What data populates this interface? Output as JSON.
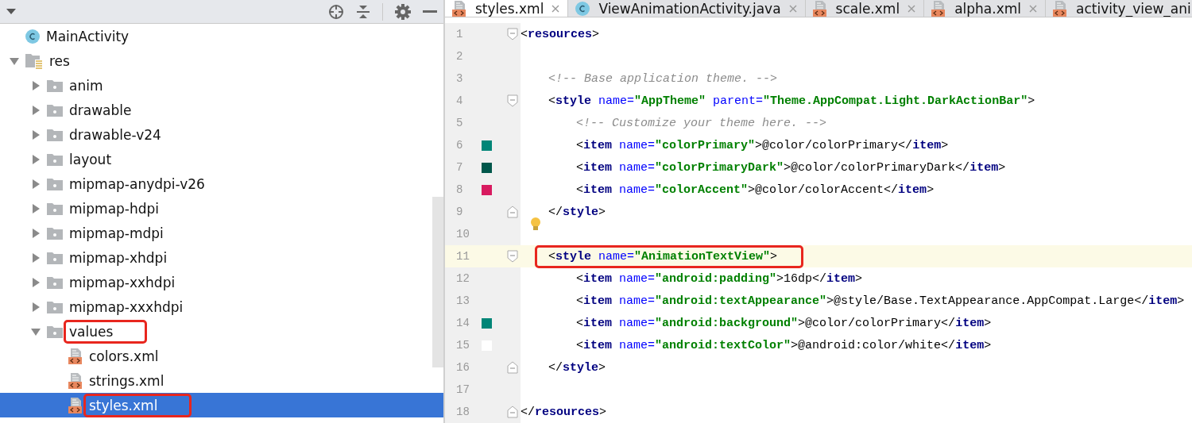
{
  "project": {
    "tree": [
      {
        "label": "MainActivity",
        "kind": "class",
        "selected": false,
        "highlighted": false
      },
      {
        "label": "res",
        "kind": "resfolder",
        "expanded": true,
        "selected": false,
        "highlighted": false,
        "children": [
          {
            "label": "anim",
            "kind": "folder",
            "expanded": false,
            "selected": false,
            "highlighted": false
          },
          {
            "label": "drawable",
            "kind": "folder",
            "expanded": false,
            "selected": false,
            "highlighted": false
          },
          {
            "label": "drawable-v24",
            "kind": "folder",
            "expanded": false,
            "selected": false,
            "highlighted": false
          },
          {
            "label": "layout",
            "kind": "folder",
            "expanded": false,
            "selected": false,
            "highlighted": false
          },
          {
            "label": "mipmap-anydpi-v26",
            "kind": "folder",
            "expanded": false,
            "selected": false,
            "highlighted": false
          },
          {
            "label": "mipmap-hdpi",
            "kind": "folder",
            "expanded": false,
            "selected": false,
            "highlighted": false
          },
          {
            "label": "mipmap-mdpi",
            "kind": "folder",
            "expanded": false,
            "selected": false,
            "highlighted": false
          },
          {
            "label": "mipmap-xhdpi",
            "kind": "folder",
            "expanded": false,
            "selected": false,
            "highlighted": false
          },
          {
            "label": "mipmap-xxhdpi",
            "kind": "folder",
            "expanded": false,
            "selected": false,
            "highlighted": false
          },
          {
            "label": "mipmap-xxxhdpi",
            "kind": "folder",
            "expanded": false,
            "selected": false,
            "highlighted": false
          },
          {
            "label": "values",
            "kind": "folder",
            "expanded": true,
            "selected": false,
            "highlighted": true,
            "children": [
              {
                "label": "colors.xml",
                "kind": "xml",
                "selected": false,
                "highlighted": false
              },
              {
                "label": "strings.xml",
                "kind": "xml",
                "selected": false,
                "highlighted": false
              },
              {
                "label": "styles.xml",
                "kind": "xml",
                "selected": true,
                "highlighted": true
              }
            ]
          }
        ]
      }
    ]
  },
  "editor": {
    "tabs": [
      {
        "label": "styles.xml",
        "kind": "xml",
        "selected": true,
        "closable": true
      },
      {
        "label": "ViewAnimationActivity.java",
        "kind": "class",
        "selected": false,
        "closable": true
      },
      {
        "label": "scale.xml",
        "kind": "xml",
        "selected": false,
        "closable": true
      },
      {
        "label": "alpha.xml",
        "kind": "xml",
        "selected": false,
        "closable": true
      },
      {
        "label": "activity_view_ani",
        "kind": "xml",
        "selected": false,
        "closable": false
      }
    ],
    "lines": [
      {
        "number": "1",
        "fold_start": true,
        "tokens": [
          {
            "kind": "punct",
            "text": "<"
          },
          {
            "kind": "tag",
            "text": "resources"
          },
          {
            "kind": "punct",
            "text": ">"
          }
        ],
        "children": [
          {
            "number": "2"
          },
          {
            "number": "3",
            "tokens": [
              {
                "kind": "comment",
                "text": "<!-- Base application theme. -->"
              }
            ]
          },
          {
            "number": "4",
            "fold_start": true,
            "tokens": [
              {
                "kind": "punct",
                "text": "<"
              },
              {
                "kind": "tag",
                "text": "style"
              },
              {
                "kind": "attr",
                "text": " name="
              },
              {
                "kind": "value",
                "text": "\"AppTheme\""
              },
              {
                "kind": "attr",
                "text": " parent="
              },
              {
                "kind": "value",
                "text": "\"Theme.AppCompat.Light.DarkActionBar\""
              },
              {
                "kind": "punct",
                "text": ">"
              }
            ],
            "children": [
              {
                "number": "5",
                "tokens": [
                  {
                    "kind": "comment",
                    "text": "<!-- Customize your theme here. -->"
                  }
                ]
              },
              {
                "number": "6",
                "color": "#008577",
                "tokens": [
                  {
                    "kind": "punct",
                    "text": "<"
                  },
                  {
                    "kind": "tag",
                    "text": "item"
                  },
                  {
                    "kind": "attr",
                    "text": " name="
                  },
                  {
                    "kind": "value",
                    "text": "\"colorPrimary\""
                  },
                  {
                    "kind": "punct",
                    "text": ">@color/colorPrimary</"
                  },
                  {
                    "kind": "tag",
                    "text": "item"
                  },
                  {
                    "kind": "punct",
                    "text": ">"
                  }
                ]
              },
              {
                "number": "7",
                "color": "#00574b",
                "tokens": [
                  {
                    "kind": "punct",
                    "text": "<"
                  },
                  {
                    "kind": "tag",
                    "text": "item"
                  },
                  {
                    "kind": "attr",
                    "text": " name="
                  },
                  {
                    "kind": "value",
                    "text": "\"colorPrimaryDark\""
                  },
                  {
                    "kind": "punct",
                    "text": ">@color/colorPrimaryDark</"
                  },
                  {
                    "kind": "tag",
                    "text": "item"
                  },
                  {
                    "kind": "punct",
                    "text": ">"
                  }
                ]
              },
              {
                "number": "8",
                "color": "#d81b60",
                "tokens": [
                  {
                    "kind": "punct",
                    "text": "<"
                  },
                  {
                    "kind": "tag",
                    "text": "item"
                  },
                  {
                    "kind": "attr",
                    "text": " name="
                  },
                  {
                    "kind": "value",
                    "text": "\"colorAccent\""
                  },
                  {
                    "kind": "punct",
                    "text": ">@color/colorAccent</"
                  },
                  {
                    "kind": "tag",
                    "text": "item"
                  },
                  {
                    "kind": "punct",
                    "text": ">"
                  }
                ]
              }
            ]
          },
          {
            "number": "9",
            "fold_end": true,
            "tokens": [
              {
                "kind": "punct",
                "text": "</"
              },
              {
                "kind": "tag",
                "text": "style"
              },
              {
                "kind": "punct",
                "text": ">"
              }
            ]
          },
          {
            "number": "10",
            "bulb": true
          },
          {
            "number": "11",
            "fold_start": true,
            "current": true,
            "highlighted": true,
            "tokens": [
              {
                "kind": "punct",
                "text": "<"
              },
              {
                "kind": "tag",
                "text": "style"
              },
              {
                "kind": "attr",
                "text": " name="
              },
              {
                "kind": "value",
                "text": "\"AnimationTextView\""
              },
              {
                "kind": "punct",
                "text": ">"
              }
            ],
            "children": [
              {
                "number": "12",
                "tokens": [
                  {
                    "kind": "punct",
                    "text": "<"
                  },
                  {
                    "kind": "tag",
                    "text": "item"
                  },
                  {
                    "kind": "attr",
                    "text": " name="
                  },
                  {
                    "kind": "value",
                    "text": "\"android:padding\""
                  },
                  {
                    "kind": "punct",
                    "text": ">16dp</"
                  },
                  {
                    "kind": "tag",
                    "text": "item"
                  },
                  {
                    "kind": "punct",
                    "text": ">"
                  }
                ]
              },
              {
                "number": "13",
                "tokens": [
                  {
                    "kind": "punct",
                    "text": "<"
                  },
                  {
                    "kind": "tag",
                    "text": "item"
                  },
                  {
                    "kind": "attr",
                    "text": " name="
                  },
                  {
                    "kind": "value",
                    "text": "\"android:textAppearance\""
                  },
                  {
                    "kind": "punct",
                    "text": ">@style/Base.TextAppearance.AppCompat.Large</"
                  },
                  {
                    "kind": "tag",
                    "text": "item"
                  },
                  {
                    "kind": "punct",
                    "text": ">"
                  }
                ]
              },
              {
                "number": "14",
                "color": "#008577",
                "tokens": [
                  {
                    "kind": "punct",
                    "text": "<"
                  },
                  {
                    "kind": "tag",
                    "text": "item"
                  },
                  {
                    "kind": "attr",
                    "text": " name="
                  },
                  {
                    "kind": "value",
                    "text": "\"android:background\""
                  },
                  {
                    "kind": "punct",
                    "text": ">@color/colorPrimary</"
                  },
                  {
                    "kind": "tag",
                    "text": "item"
                  },
                  {
                    "kind": "punct",
                    "text": ">"
                  }
                ]
              },
              {
                "number": "15",
                "color": "#ffffff",
                "tokens": [
                  {
                    "kind": "punct",
                    "text": "<"
                  },
                  {
                    "kind": "tag",
                    "text": "item"
                  },
                  {
                    "kind": "attr",
                    "text": " name="
                  },
                  {
                    "kind": "value",
                    "text": "\"android:textColor\""
                  },
                  {
                    "kind": "punct",
                    "text": ">@android:color/white</"
                  },
                  {
                    "kind": "tag",
                    "text": "item"
                  },
                  {
                    "kind": "punct",
                    "text": ">"
                  }
                ]
              }
            ]
          },
          {
            "number": "16",
            "fold_end": true,
            "tokens": [
              {
                "kind": "punct",
                "text": "</"
              },
              {
                "kind": "tag",
                "text": "style"
              },
              {
                "kind": "punct",
                "text": ">"
              }
            ]
          },
          {
            "number": "17"
          }
        ]
      },
      {
        "number": "18",
        "fold_end": true,
        "tokens": [
          {
            "kind": "punct",
            "text": "</"
          },
          {
            "kind": "tag",
            "text": "resources"
          },
          {
            "kind": "punct",
            "text": ">"
          }
        ]
      }
    ]
  }
}
